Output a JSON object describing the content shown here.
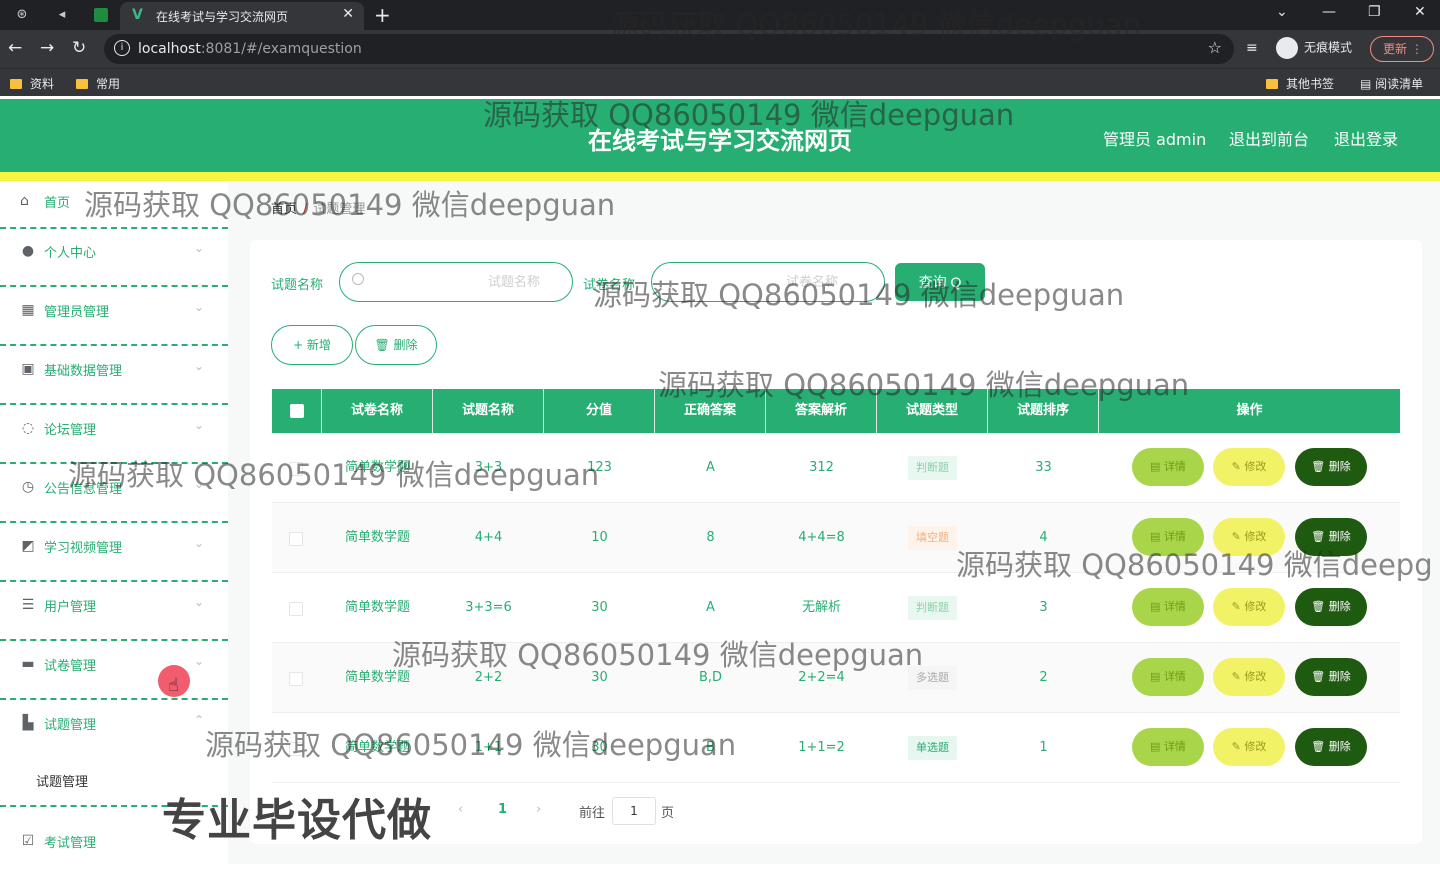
{
  "browser": {
    "tab_title": "在线考试与学习交流网页",
    "url_host": "localhost",
    "url_rest": ":8081/#/examquestion",
    "incognito_label": "无痕模式",
    "update_label": "更新",
    "bookmarks": [
      "资料",
      "常用"
    ],
    "bookmarks_right": [
      "其他书签",
      "阅读清单"
    ]
  },
  "header": {
    "title": "在线考试与学习交流网页",
    "user": "管理员 admin",
    "back_front": "退出到前台",
    "logout": "退出登录"
  },
  "sidebar": {
    "home": "首页",
    "items": [
      {
        "label": "个人中心",
        "icon": "user-icon"
      },
      {
        "label": "管理员管理",
        "icon": "grid-icon"
      },
      {
        "label": "基础数据管理",
        "icon": "data-icon"
      },
      {
        "label": "论坛管理",
        "icon": "power-icon"
      },
      {
        "label": "公告信息管理",
        "icon": "clock-icon"
      },
      {
        "label": "学习视频管理",
        "icon": "chart-icon"
      },
      {
        "label": "用户管理",
        "icon": "list-icon"
      },
      {
        "label": "试卷管理",
        "icon": "chat-icon"
      },
      {
        "label": "试题管理",
        "icon": "briefcase-icon"
      }
    ],
    "sub_item": "试题管理",
    "last_item": "考试管理"
  },
  "breadcrumb": {
    "home": "首页",
    "current": "试题管理"
  },
  "search": {
    "label1": "试题名称",
    "placeholder1": "试题名称",
    "label2": "试卷名称",
    "placeholder2": "试卷名称",
    "button": "查询 Q"
  },
  "actions": {
    "add": "+ 新增",
    "delete": "删除"
  },
  "table": {
    "headers": [
      "试卷名称",
      "试题名称",
      "分值",
      "正确答案",
      "答案解析",
      "试题类型",
      "试题排序",
      "操作"
    ],
    "rows": [
      {
        "paper": "简单数学题",
        "name": "3+3",
        "score": "123",
        "answer": "A",
        "analysis": "312",
        "type": "判断题",
        "type_class": "judge",
        "order": "33"
      },
      {
        "paper": "简单数学题",
        "name": "4+4",
        "score": "10",
        "answer": "8",
        "analysis": "4+4=8",
        "type": "填空题",
        "type_class": "fill",
        "order": "4"
      },
      {
        "paper": "简单数学题",
        "name": "3+3=6",
        "score": "30",
        "answer": "A",
        "analysis": "无解析",
        "type": "判断题",
        "type_class": "judge",
        "order": "3"
      },
      {
        "paper": "简单数学题",
        "name": "2+2",
        "score": "30",
        "answer": "B,D",
        "analysis": "2+2=4",
        "type": "多选题",
        "type_class": "multi",
        "order": "2"
      },
      {
        "paper": "简单数学题",
        "name": "1+1",
        "score": "30",
        "answer": "B",
        "analysis": "1+1=2",
        "type": "单选题",
        "type_class": "single",
        "order": "1"
      }
    ],
    "row_actions": {
      "detail": "详情",
      "edit": "修改",
      "del": "删除"
    }
  },
  "pagination": {
    "current": "1",
    "goto_label": "前往",
    "page_value": "1",
    "page_suffix": "页"
  },
  "watermarks": {
    "qq": "源码获取 QQ86050149 微信deepguan",
    "qq_cut": "源码获取 QQ86050149 微信deepg",
    "big": "专业毕设代做"
  }
}
